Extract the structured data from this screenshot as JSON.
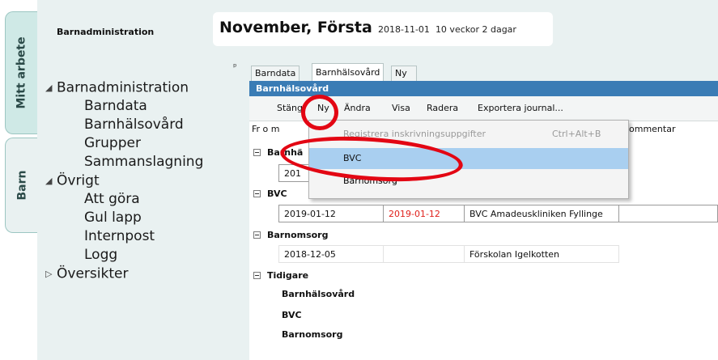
{
  "side_tabs": [
    "Mitt arbete",
    "Barn"
  ],
  "nav": {
    "title": "Barnadministration",
    "tree": [
      {
        "label": "Barnadministration",
        "level": 0,
        "expander": "◢"
      },
      {
        "label": "Barndata",
        "level": 1
      },
      {
        "label": "Barnhälsovård",
        "level": 1
      },
      {
        "label": "Grupper",
        "level": 1
      },
      {
        "label": "Sammanslagning",
        "level": 1
      },
      {
        "label": "Övrigt",
        "level": 0,
        "expander": "◢"
      },
      {
        "label": "Att göra",
        "level": 1
      },
      {
        "label": "Gul lapp",
        "level": 1
      },
      {
        "label": "Internpost",
        "level": 1
      },
      {
        "label": "Logg",
        "level": 1
      },
      {
        "label": "Översikter",
        "level": 0,
        "expander": "▷"
      }
    ]
  },
  "header": {
    "title": "November, Första",
    "date": "2018-11-01",
    "age": "10 veckor 2 dagar"
  },
  "pin_glyph": "ᵖ",
  "tabs": [
    "Barndata",
    "Barnhälsovård",
    "Ny BVC"
  ],
  "active_tab": "Barnhälsovård",
  "panel_title": "Barnhälsovård",
  "toolbar": [
    "Stäng",
    "Ny",
    "Ändra",
    "Visa",
    "Radera",
    "Exportera journal..."
  ],
  "columns": {
    "from": "Fr o m",
    "comment": "ommentar"
  },
  "groups": {
    "barnhalsovard": "Barnhä",
    "barnhalsovard_row_partial": "201",
    "bvc": "BVC",
    "barnomsorg": "Barnomsorg",
    "tidigare": "Tidigare"
  },
  "bvc_row": {
    "from": "2019-01-12",
    "to": "2019-01-12",
    "place": "BVC Amadeuskliniken Fyllinge"
  },
  "barnomsorg_row": {
    "from": "2018-12-05",
    "to": "",
    "place": "Förskolan Igelkotten"
  },
  "tidigare_items": [
    "Barnhälsovård",
    "BVC",
    "Barnomsorg"
  ],
  "menu": {
    "items": [
      {
        "label": "Registrera inskrivningsuppgifter",
        "shortcut": "Ctrl+Alt+B",
        "state": "disabled"
      },
      {
        "label": "BVC",
        "shortcut": "",
        "state": "selected"
      },
      {
        "label": "Barnomsorg",
        "shortcut": "",
        "state": "normal"
      }
    ]
  },
  "colors": {
    "accent": "#3a7cb5",
    "highlight": "#e30613",
    "menu_selected": "#a9cff0",
    "date_red": "#e0201b"
  }
}
